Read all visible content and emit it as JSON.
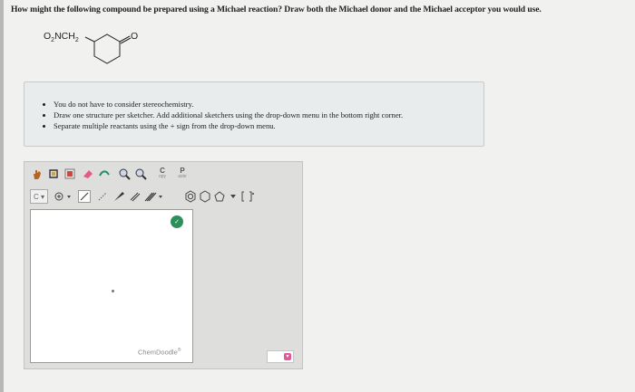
{
  "question": {
    "text": "How might the following compound be prepared using a Michael reaction? Draw both the Michael donor and the Michael acceptor you would use."
  },
  "compound": {
    "substituent_main": "O",
    "substituent_sub": "2",
    "substituent_mid": "NCH",
    "substituent_sub2": "2",
    "oxygen_label": "O"
  },
  "instructions": {
    "items": [
      "You do not have to consider stereochemistry.",
      "Draw one structure per sketcher. Add additional sketchers using the drop-down menu in the bottom right corner.",
      "Separate multiple reactants using the + sign from the drop-down menu."
    ]
  },
  "sketcher": {
    "copy_big": "C",
    "copy_small": "opy",
    "paste_big": "P",
    "paste_small": "aste",
    "element_dropdown": "C ▾",
    "badge_text": "✓",
    "brand": "ChemDoodle",
    "brand_mark": "®"
  },
  "colors": {
    "background": "#f1f1ef",
    "badge_green": "#2f8f5b",
    "menu_pink": "#e0589b"
  }
}
